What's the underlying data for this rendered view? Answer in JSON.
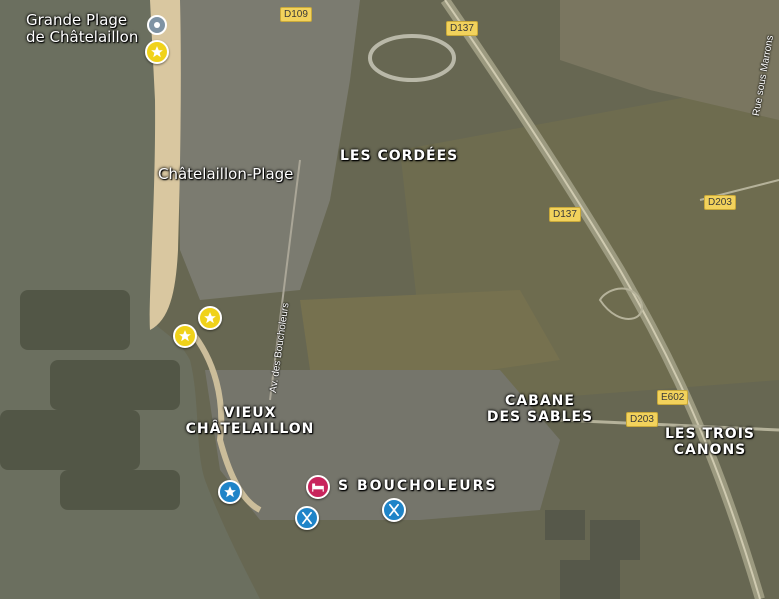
{
  "map": {
    "place_labels": {
      "grande_plage": "Grande Plage\nde Châtelaillon",
      "chatelaillon_plage": "Châtelaillon-Plage",
      "les_cordees": "LES CORDÉES",
      "vieux_chatelaillon": "VIEUX\nCHÂTELAILLON",
      "cabane_des_sables": "CABANE\nDES SABLES",
      "les_trois_canons": "LES TROIS\nCANONS",
      "les_boucholeurs": "S BOUCHOLEURS"
    },
    "road_shields": {
      "d109": "D109",
      "d137_top": "D137",
      "d137_mid": "D137",
      "d203_right": "D203",
      "d203_bottom": "D203",
      "e602": "E602"
    },
    "road_names": {
      "av_des_boucholeurs": "Av. des Boucholeurs",
      "rue_sous_marrons": "Rue sous Marrons"
    },
    "colors": {
      "sea": "#6b6f5f",
      "beach": "#d9c7a0",
      "town": "#7a7a6e",
      "fields": "#6b6a4e",
      "highway": "#9c9a80",
      "star_pin": "#f0d21a",
      "blue_pin": "#1f84c8",
      "hotel_pin": "#c8245c",
      "shield": "#f2d25c"
    },
    "markers": [
      {
        "type": "beach",
        "icon": "beach-umbrella-icon"
      },
      {
        "type": "starred-place",
        "icon": "star-icon"
      },
      {
        "type": "starred-place",
        "icon": "star-icon"
      },
      {
        "type": "starred-place",
        "icon": "star-icon"
      },
      {
        "type": "starred-place-blue",
        "icon": "star-icon"
      },
      {
        "type": "hotel",
        "icon": "bed-icon"
      },
      {
        "type": "restaurant",
        "icon": "fork-knife-icon"
      },
      {
        "type": "restaurant",
        "icon": "fork-knife-icon"
      }
    ]
  }
}
